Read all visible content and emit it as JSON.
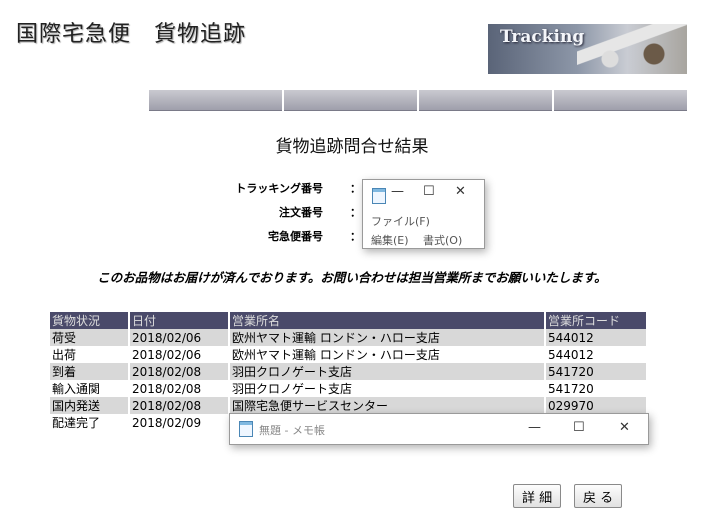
{
  "site": {
    "title": "国際宅急便　貨物追跡",
    "banner_label": "Tracking"
  },
  "page_title": "貨物追跡問合せ結果",
  "info": {
    "tracking_label": "トラッキング番号",
    "order_label": "注文番号",
    "delivery_label": "宅急便番号",
    "colon": "："
  },
  "notice": "このお品物はお届けが済んでおります。お問い合わせは担当営業所までお願いいたします。",
  "table": {
    "headers": [
      "貨物状況",
      "日付",
      "営業所名",
      "営業所コード"
    ],
    "rows": [
      [
        "荷受",
        "2018/02/06",
        "欧州ヤマト運輸 ロンドン・ハロー支店",
        "544012"
      ],
      [
        "出荷",
        "2018/02/06",
        "欧州ヤマト運輸 ロンドン・ハロー支店",
        "544012"
      ],
      [
        "到着",
        "2018/02/08",
        "羽田クロノゲート支店",
        "541720"
      ],
      [
        "輸入通関",
        "2018/02/08",
        "羽田クロノゲート支店",
        "541720"
      ],
      [
        "国内発送",
        "2018/02/08",
        "国際宅急便サービスセンター",
        "029970"
      ],
      [
        "配達完了",
        "2018/02/09",
        "",
        ""
      ]
    ]
  },
  "buttons": {
    "details": "詳 細",
    "back": "戻 る"
  },
  "notepad_small": {
    "minimize": "—",
    "maximize": "☐",
    "close": "✕",
    "menu_file": "ファイル(F)",
    "menu_edit": "編集(E)",
    "menu_format": "書式(O)"
  },
  "notepad_wide": {
    "title": "無題 - メモ帳",
    "minimize": "—",
    "maximize": "☐",
    "close": "✕"
  },
  "icons": {
    "notepad": "notepad-icon"
  }
}
